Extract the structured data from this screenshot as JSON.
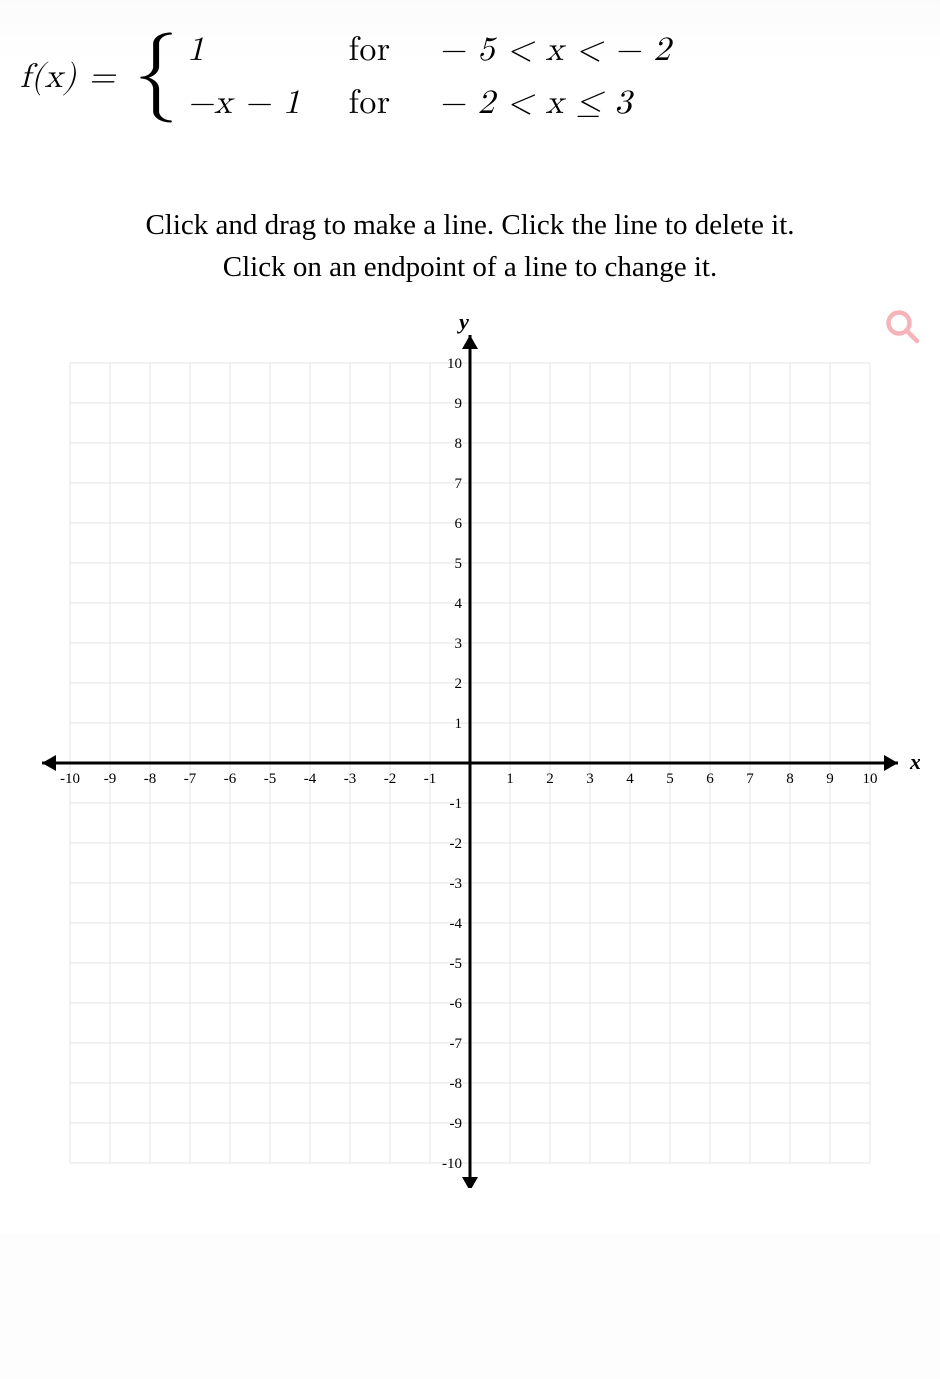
{
  "formula": {
    "lhs": "f(x) =",
    "pieces": [
      {
        "expr": "1",
        "for_word": "for",
        "cond": "− 5 < x < − 2"
      },
      {
        "expr": "−x − 1",
        "for_word": "for",
        "cond": "− 2 < x ≤ 3"
      }
    ]
  },
  "instructions": {
    "line1": "Click and drag to make a line. Click the line to delete it.",
    "line2": "Click on an endpoint of a line to change it."
  },
  "chart_data": {
    "type": "line",
    "title": "",
    "xlabel": "x",
    "ylabel": "y",
    "xlim": [
      -10,
      10
    ],
    "ylim": [
      -10,
      10
    ],
    "xticks": [
      -10,
      -9,
      -8,
      -7,
      -6,
      -5,
      -4,
      -3,
      -2,
      -1,
      1,
      2,
      3,
      4,
      5,
      6,
      7,
      8,
      9,
      10
    ],
    "yticks": [
      -10,
      -9,
      -8,
      -7,
      -6,
      -5,
      -4,
      -3,
      -2,
      -1,
      1,
      2,
      3,
      4,
      5,
      6,
      7,
      8,
      9,
      10
    ],
    "series": []
  }
}
